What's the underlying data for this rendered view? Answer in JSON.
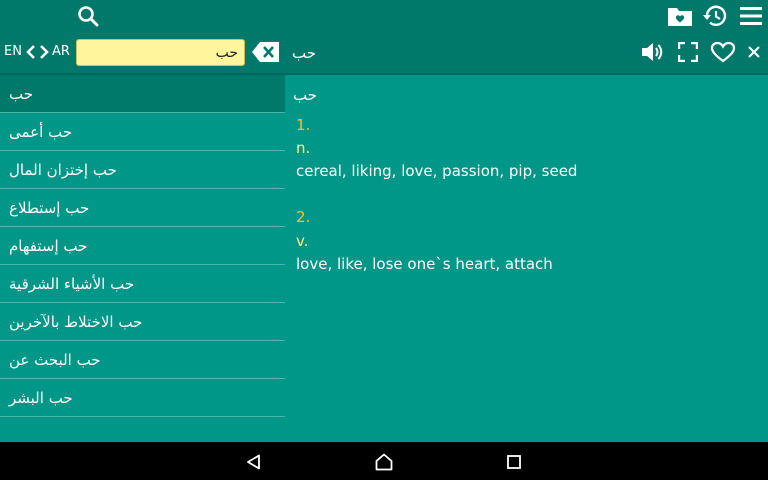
{
  "toolbar": {
    "icons": [
      "search-icon",
      "saved-folder-icon",
      "history-icon",
      "menu-icon"
    ]
  },
  "searchbar": {
    "source_lang": "EN",
    "target_lang": "AR",
    "query": "حب",
    "headword": "حب",
    "icons": [
      "swap-languages-icon",
      "clear-input-icon",
      "speaker-icon",
      "fullscreen-icon",
      "heart-icon",
      "close-icon"
    ]
  },
  "sidebar": {
    "items": [
      {
        "label": "حب",
        "selected": true
      },
      {
        "label": "حب أعمى"
      },
      {
        "label": "حب إختزان المال"
      },
      {
        "label": "حب إستطلاع"
      },
      {
        "label": "حب إستفهام"
      },
      {
        "label": "حب الأشياء الشرقية"
      },
      {
        "label": "حب الاختلاط بالآخرين"
      },
      {
        "label": "حب البحث عن"
      },
      {
        "label": "حب البشر"
      }
    ]
  },
  "entry": {
    "word": "حب",
    "senses": [
      {
        "num": "1.",
        "pos": "n.",
        "definition": "cereal, liking, love, passion, pip, seed"
      },
      {
        "num": "2.",
        "pos": "v.",
        "definition": "love, like, lose one`s heart, attach"
      }
    ]
  },
  "navbar": {
    "icons": [
      "back-icon",
      "home-icon",
      "recents-icon"
    ]
  },
  "colors": {
    "appbar": "#00796b",
    "background": "#009688",
    "search_field": "#fff59d",
    "sense_number": "#fbc02d",
    "part_of_speech": "#fff176"
  }
}
